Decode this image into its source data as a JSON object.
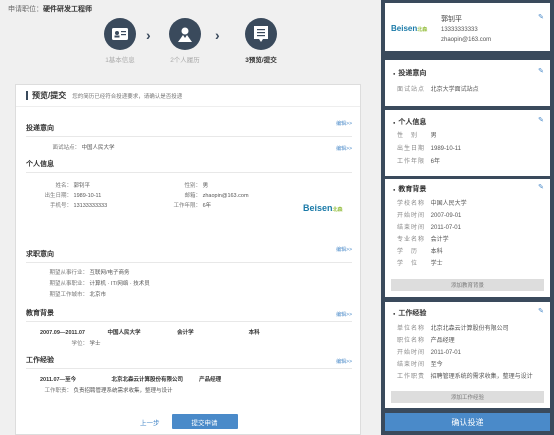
{
  "topbar": {
    "prefix": "申请职位：",
    "position": "硬件研发工程师"
  },
  "steps": [
    {
      "label": "1基本信息",
      "state": "done"
    },
    {
      "label": "2个人履历",
      "state": "todo"
    },
    {
      "label": "3预览/提交",
      "state": "active"
    }
  ],
  "preview": {
    "title": "预览/提交",
    "hint": "您的简历已经符合投递要求，请确认是否投递",
    "edit_label": "编辑>>",
    "intention": {
      "title": "投递意向",
      "site_label": "面试站点：",
      "site": "中国人民大学"
    },
    "personal": {
      "title": "个人信息",
      "name_label": "姓名：",
      "name": "郭钊平",
      "gender_label": "性别：",
      "gender": "男",
      "birth_label": "出生日期：",
      "birth": "1989-10-11",
      "email_label": "邮箱：",
      "email": "zhaopin@163.com",
      "phone_label": "手机号：",
      "phone": "13133333333",
      "years_label": "工作年限：",
      "years": "6年"
    },
    "logo": {
      "text": "Beisen",
      "sub": "北森"
    },
    "job_intention": {
      "title": "求职意向",
      "industry_label": "期望从事行业：",
      "industry": "互联网/电子商务",
      "job_label": "期望从事职业：",
      "job": "计算机 · IT/网络 · 技术员",
      "city_label": "期望工作城市：",
      "city": "北京市"
    },
    "education": {
      "title": "教育背景",
      "period": "2007.09—2011.07",
      "school": "中国人民大学",
      "major": "会计学",
      "degree_level": "本科",
      "degree_label": "学位：",
      "degree": "学士"
    },
    "work": {
      "title": "工作经验",
      "period": "2011.07—至今",
      "company": "北京北森云计算股份有限公司",
      "role": "产品经理",
      "duty_label": "工作职责：",
      "duty": "负责招聘管理系统需求收集，整理与设计"
    },
    "prev_label": "上一步",
    "submit_label": "提交申请"
  },
  "side": {
    "profile": {
      "name": "郭钊平",
      "phone": "13333333333",
      "email": "zhaopin@163.com",
      "logo": "Beisen",
      "logo_sub": "北森"
    },
    "intention": {
      "title": "投递意向",
      "site_label": "面试站点",
      "site": "北京大学面试站点"
    },
    "personal": {
      "title": "个人信息",
      "rows": [
        {
          "k": "性　别",
          "v": "男"
        },
        {
          "k": "出生日期",
          "v": "1989-10-11"
        },
        {
          "k": "工作年限",
          "v": "6年"
        }
      ]
    },
    "education": {
      "title": "教育背景",
      "rows": [
        {
          "k": "学校名称",
          "v": "中国人民大学"
        },
        {
          "k": "开始时间",
          "v": "2007-09-01"
        },
        {
          "k": "结束时间",
          "v": "2011-07-01"
        },
        {
          "k": "专业名称",
          "v": "会计学"
        },
        {
          "k": "学　历",
          "v": "本科"
        },
        {
          "k": "学　位",
          "v": "学士"
        }
      ],
      "add_label": "添加教育背景"
    },
    "work": {
      "title": "工作经验",
      "rows": [
        {
          "k": "单位名称",
          "v": "北京北森云计算股份有限公司"
        },
        {
          "k": "职位名称",
          "v": "产品经理"
        },
        {
          "k": "开始时间",
          "v": "2011-07-01"
        },
        {
          "k": "结束时间",
          "v": "至今"
        },
        {
          "k": "工作职责",
          "v": "招聘管理系统的需求收集，整理与设计"
        }
      ],
      "add_label": "添加工作经验"
    },
    "confirm_label": "确认投递"
  }
}
